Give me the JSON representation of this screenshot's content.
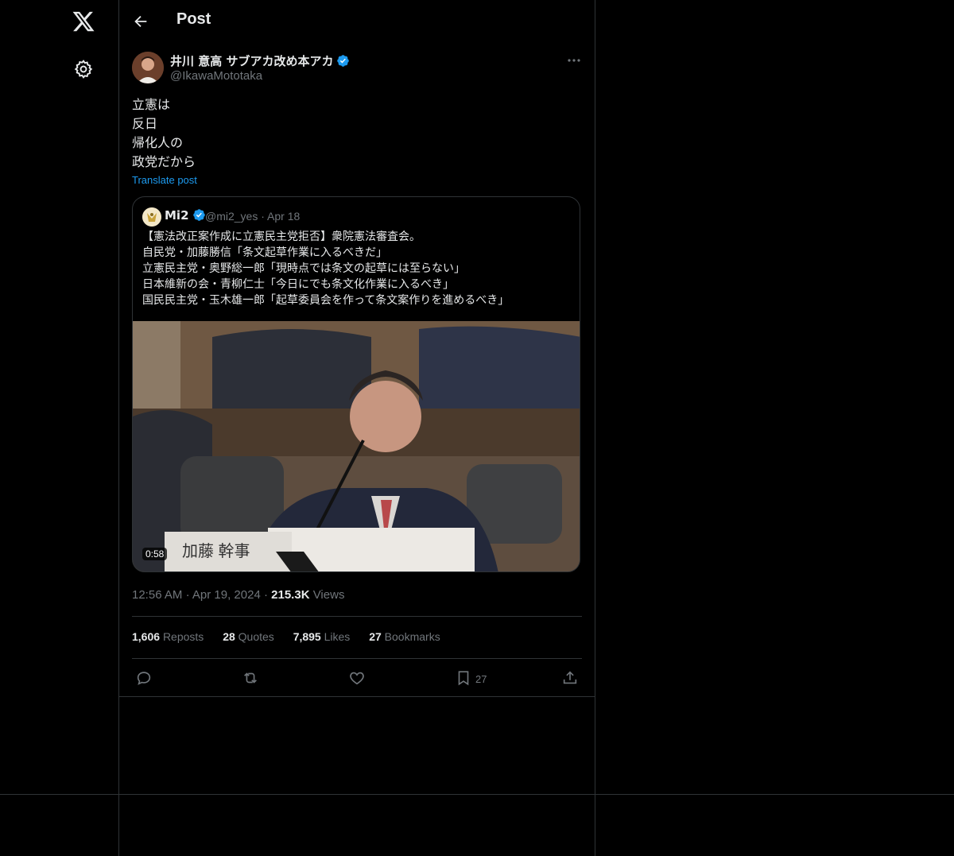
{
  "nav": {
    "logo_icon": "x-logo-icon",
    "settings_icon": "gear-icon"
  },
  "header": {
    "title": "Post"
  },
  "post": {
    "author_name": "井川 意高 サブアカ改め本アカ",
    "handle": "@IkawaMototaka",
    "lines": [
      "立憲は",
      "反日",
      "帰化人の",
      "政党だから"
    ],
    "translate": "Translate post",
    "time": "12:56 AM",
    "date": "Apr 19, 2024",
    "views": "215.3K",
    "views_label": "Views"
  },
  "quote": {
    "name": "Mi2",
    "handle": "@mi2_yes",
    "date": "Apr 18",
    "lines": [
      "【憲法改正案作成に立憲民主党拒否】衆院憲法審査会。",
      "自民党・加藤勝信「条文起草作業に入るべきだ」",
      "立憲民主党・奥野総一郎「現時点では条文の起草には至らない」",
      "日本維新の会・青柳仁士「今日にでも条文化作業に入るべき」",
      "国民民主党・玉木雄一郎「起草委員会を作って条文案作りを進めるべき」"
    ],
    "video_duration": "0:58",
    "video_caption": "加藤 幹事"
  },
  "stats": {
    "reposts": "1,606",
    "reposts_label": "Reposts",
    "quotes": "28",
    "quotes_label": "Quotes",
    "likes": "7,895",
    "likes_label": "Likes",
    "bookmarks": "27",
    "bookmarks_label": "Bookmarks"
  },
  "actions": {
    "bookmark_count": "27"
  },
  "colors": {
    "accent": "#1d9bf0",
    "background": "#000000",
    "border": "#2f3336",
    "muted": "#71767b"
  }
}
